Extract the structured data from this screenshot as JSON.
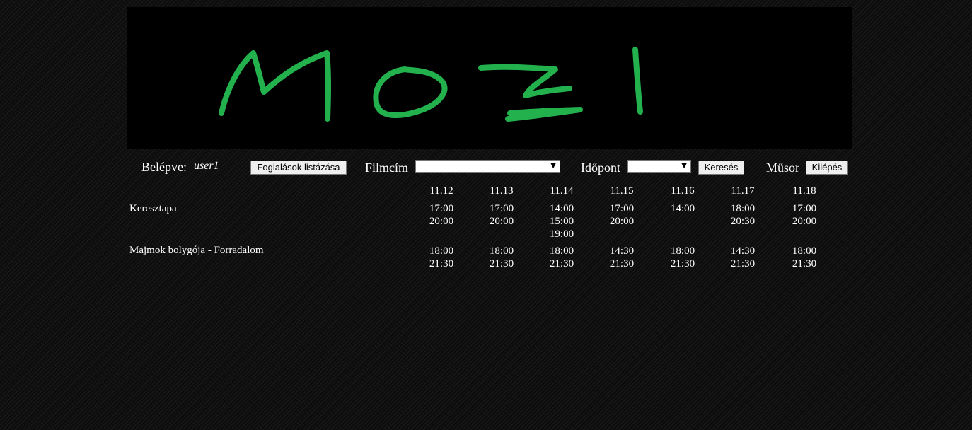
{
  "banner": {
    "logo_text": "MOZI",
    "logo_color": "#22b14c",
    "background": "#000000"
  },
  "toolbar": {
    "logged_in_label": "Belépve:",
    "username": "user1",
    "list_bookings_label": "Foglalások listázása",
    "film_title_label": "Filmcím",
    "film_title_value": "",
    "time_label": "Időpont",
    "time_value": "",
    "search_label": "Keresés",
    "program_label": "Műsor",
    "logout_label": "Kilépés"
  },
  "schedule": {
    "dates": [
      "11.12",
      "11.13",
      "11.14",
      "11.15",
      "11.16",
      "11.17",
      "11.18"
    ],
    "movies": [
      {
        "title": "Keresztapa",
        "times": [
          [
            "17:00",
            "20:00"
          ],
          [
            "17:00",
            "20:00"
          ],
          [
            "14:00",
            "15:00",
            "19:00"
          ],
          [
            "17:00",
            "20:00"
          ],
          [
            "14:00"
          ],
          [
            "18:00",
            "20:30"
          ],
          [
            "17:00",
            "20:00"
          ]
        ]
      },
      {
        "title": "Majmok bolygója - Forradalom",
        "times": [
          [
            "18:00",
            "21:30"
          ],
          [
            "18:00",
            "21:30"
          ],
          [
            "18:00",
            "21:30"
          ],
          [
            "14:30",
            "21:30"
          ],
          [
            "18:00",
            "21:30"
          ],
          [
            "14:30",
            "21:30"
          ],
          [
            "18:00",
            "21:30"
          ]
        ]
      }
    ]
  }
}
